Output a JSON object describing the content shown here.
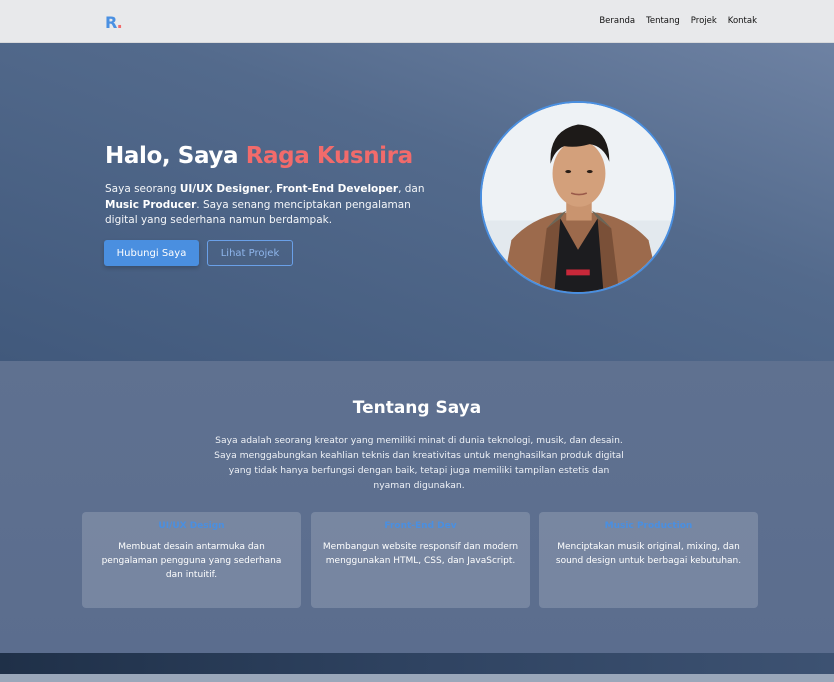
{
  "nav": {
    "logo_letter": "R",
    "logo_dot": ".",
    "links": [
      "Beranda",
      "Tentang",
      "Projek",
      "Kontak"
    ]
  },
  "hero": {
    "greeting": "Halo, Saya ",
    "name": "Raga Kusnira",
    "intro_1": "Saya seorang ",
    "role_1": "UI/UX Designer",
    "sep_1": ", ",
    "role_2": "Front-End Developer",
    "sep_2": ", dan ",
    "role_3": "Music Producer",
    "intro_2": ". Saya senang menciptakan pengalaman digital yang sederhana namun berdampak.",
    "primary_button": "Hubungi Saya",
    "secondary_button": "Lihat Projek"
  },
  "about": {
    "title": "Tentang Saya",
    "text": "Saya adalah seorang kreator yang memiliki minat di dunia teknologi, musik, dan desain. Saya menggabungkan keahlian teknis dan kreativitas untuk menghasilkan produk digital yang tidak hanya berfungsi dengan baik, tetapi juga memiliki tampilan estetis dan nyaman digunakan.",
    "cards": [
      {
        "title": "UI/UX Design",
        "desc": "Membuat desain antarmuka dan pengalaman pengguna yang sederhana dan intuitif."
      },
      {
        "title": "Front-End Dev",
        "desc": "Membangun website responsif dan modern menggunakan HTML, CSS, dan JavaScript."
      },
      {
        "title": "Music Production",
        "desc": "Menciptakan musik original, mixing, dan sound design untuk berbagai kebutuhan."
      }
    ]
  },
  "colors": {
    "accent": "#4a8fe0",
    "highlight": "#f26b6b"
  }
}
